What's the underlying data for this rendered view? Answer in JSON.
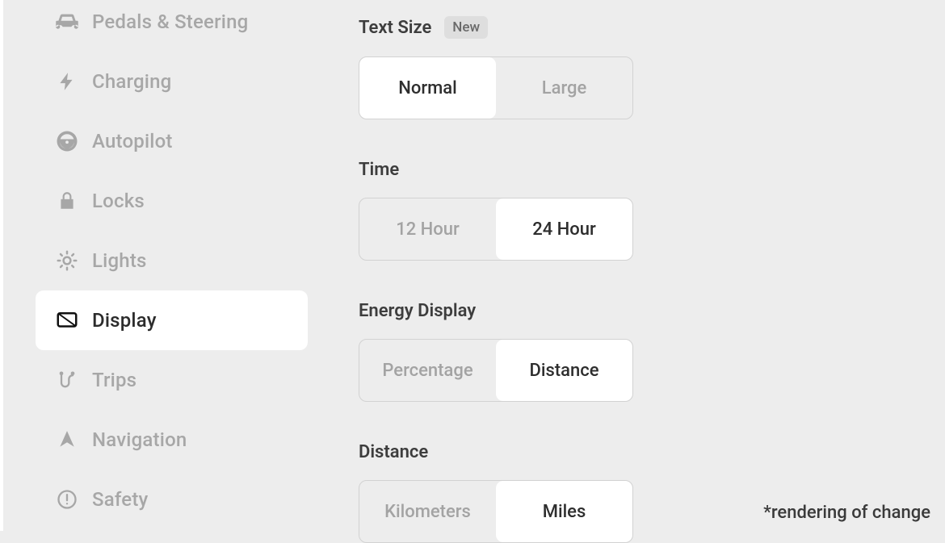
{
  "sidebar": {
    "items": [
      {
        "label": "Pedals & Steering"
      },
      {
        "label": "Charging"
      },
      {
        "label": "Autopilot"
      },
      {
        "label": "Locks"
      },
      {
        "label": "Lights"
      },
      {
        "label": "Display"
      },
      {
        "label": "Trips"
      },
      {
        "label": "Navigation"
      },
      {
        "label": "Safety"
      }
    ]
  },
  "settings": {
    "text_size": {
      "label": "Text Size",
      "badge": "New",
      "options": {
        "a": "Normal",
        "b": "Large"
      }
    },
    "time": {
      "label": "Time",
      "options": {
        "a": "12 Hour",
        "b": "24 Hour"
      }
    },
    "energy": {
      "label": "Energy Display",
      "options": {
        "a": "Percentage",
        "b": "Distance"
      }
    },
    "distance": {
      "label": "Distance",
      "options": {
        "a": "Kilometers",
        "b": "Miles"
      }
    }
  },
  "footnote": "*rendering of change"
}
